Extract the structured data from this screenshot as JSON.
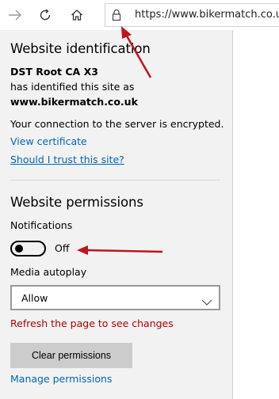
{
  "toolbar": {
    "back_icon": "back-arrow-icon",
    "refresh_icon": "refresh-icon",
    "home_icon": "home-icon",
    "lock_icon": "lock-icon",
    "url": "https://www.bikermatch.co.uk,"
  },
  "identification": {
    "title": "Website identification",
    "issuer": "DST Root CA X3",
    "identified_text": "has identified this site as",
    "site": "www.bikermatch.co.uk",
    "encrypted_text": "Your connection to the server is encrypted.",
    "view_certificate": "View certificate",
    "trust_link": "Should I trust this site?"
  },
  "permissions": {
    "title": "Website permissions",
    "notifications_label": "Notifications",
    "notifications_state": "Off",
    "media_label": "Media autoplay",
    "media_value": "Allow",
    "refresh_notice": "Refresh the page to see changes",
    "clear_button": "Clear permissions",
    "manage_link": "Manage permissions"
  },
  "colors": {
    "link": "#0067b8",
    "warning": "#b40000",
    "annotation_arrow": "#c0141e",
    "panel_bg": "#f2f2f2"
  }
}
